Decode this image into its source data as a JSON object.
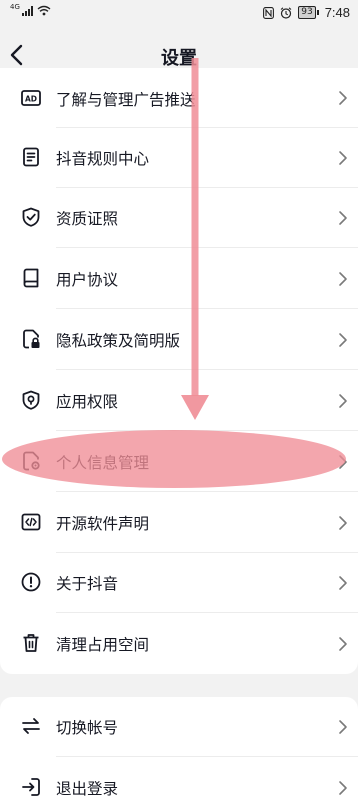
{
  "status_bar": {
    "network": "4G",
    "battery": "93",
    "time": "7:48"
  },
  "header": {
    "title": "设置"
  },
  "colors": {
    "annotation": "#f08d96",
    "text": "#161823",
    "icon": "#161823",
    "chevron": "#7a7a7a"
  },
  "section_about": {
    "items": [
      {
        "label": "了解与管理广告推送",
        "icon": "ad-icon"
      },
      {
        "label": "抖音规则中心",
        "icon": "document-list-icon"
      },
      {
        "label": "资质证照",
        "icon": "shield-check-icon"
      },
      {
        "label": "用户协议",
        "icon": "book-icon"
      },
      {
        "label": "隐私政策及简明版",
        "icon": "document-lock-icon"
      },
      {
        "label": "应用权限",
        "icon": "shield-location-icon"
      },
      {
        "label": "个人信息管理",
        "icon": "document-gear-icon"
      },
      {
        "label": "开源软件声明",
        "icon": "code-icon"
      },
      {
        "label": "关于抖音",
        "icon": "info-circle-icon"
      },
      {
        "label": "清理占用空间",
        "icon": "trash-icon"
      }
    ]
  },
  "section_account": {
    "items": [
      {
        "label": "切换帐号",
        "icon": "switch-arrows-icon"
      },
      {
        "label": "退出登录",
        "icon": "logout-icon"
      }
    ]
  }
}
